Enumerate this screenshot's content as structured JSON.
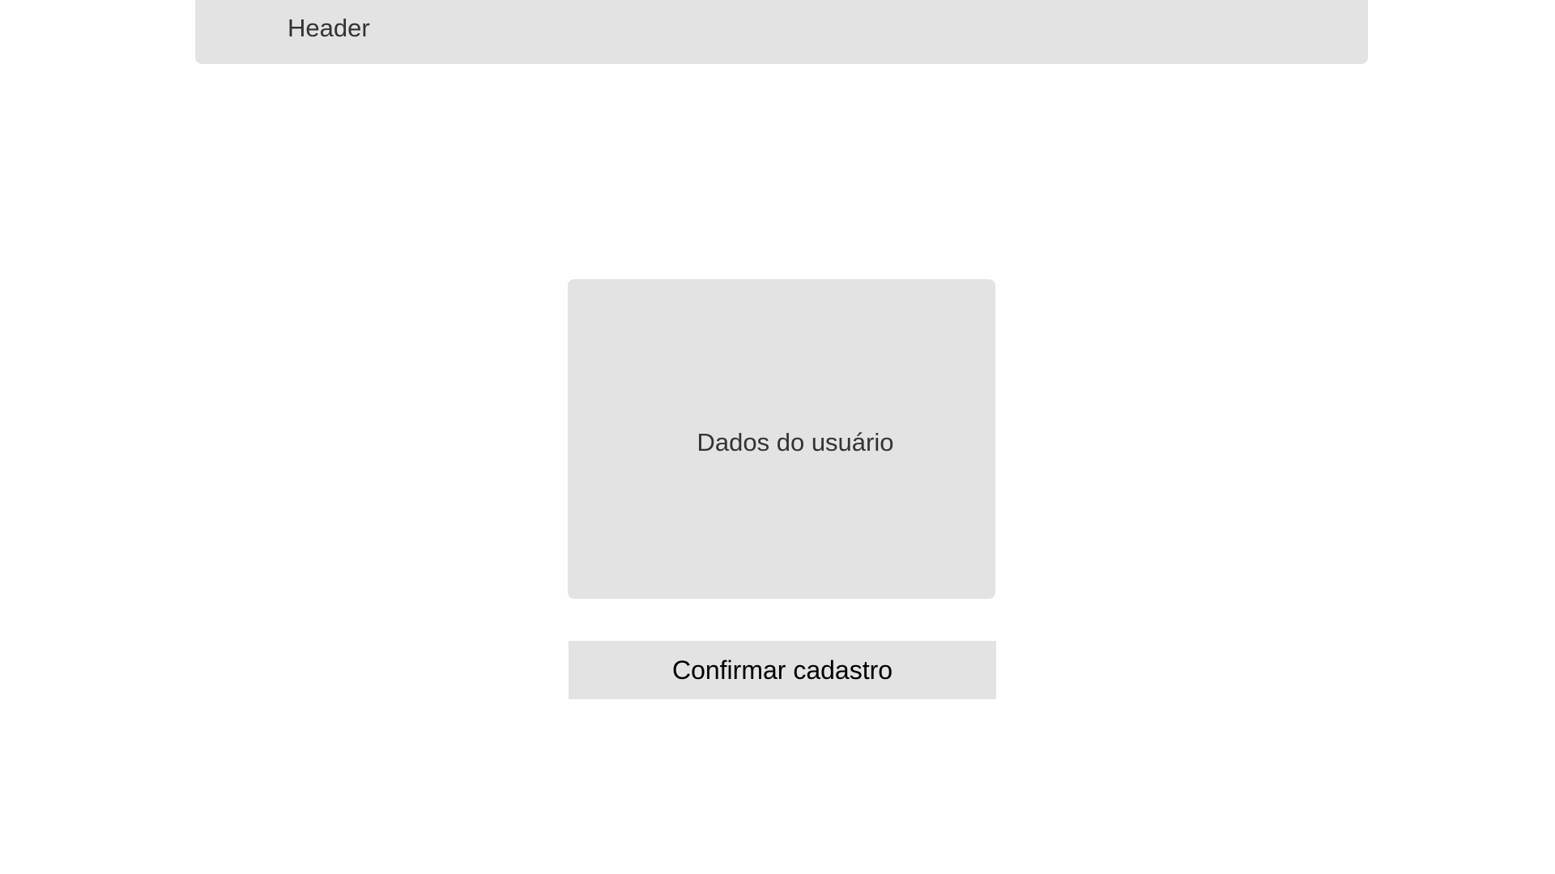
{
  "header": {
    "title": "Header"
  },
  "user_card": {
    "label": "Dados do usuário"
  },
  "actions": {
    "confirm_label": "Confirmar cadastro"
  },
  "colors": {
    "background": "#fefefe",
    "panel": "#e3e3e3",
    "text_muted": "#333333",
    "text_strong": "#000000"
  }
}
